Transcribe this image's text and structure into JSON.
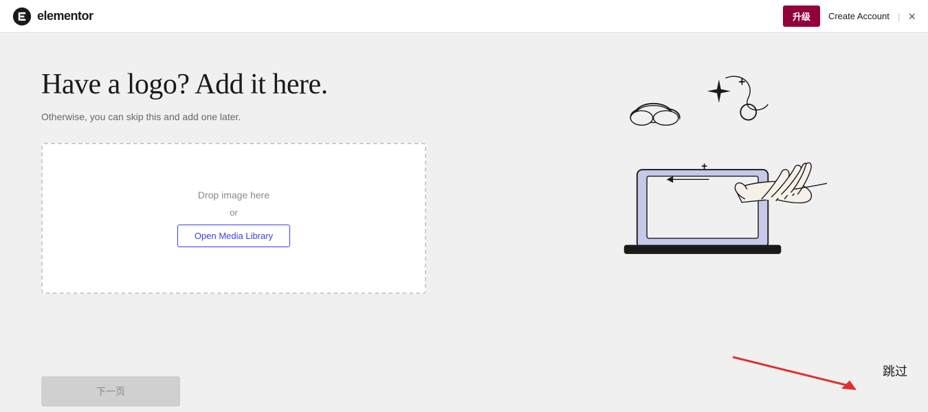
{
  "nav": {
    "logo_text": "elementor",
    "upgrade_label": "升级",
    "create_account_label": "Create Account",
    "close_icon": "×"
  },
  "main": {
    "title": "Have a logo? Add it here.",
    "subtitle": "Otherwise, you can skip this and add one later.",
    "drop_zone": {
      "drop_text": "Drop image here",
      "or_text": "or",
      "open_media_btn_label": "Open Media Library"
    },
    "next_btn_label": "下一页",
    "skip_label": "跳过"
  }
}
